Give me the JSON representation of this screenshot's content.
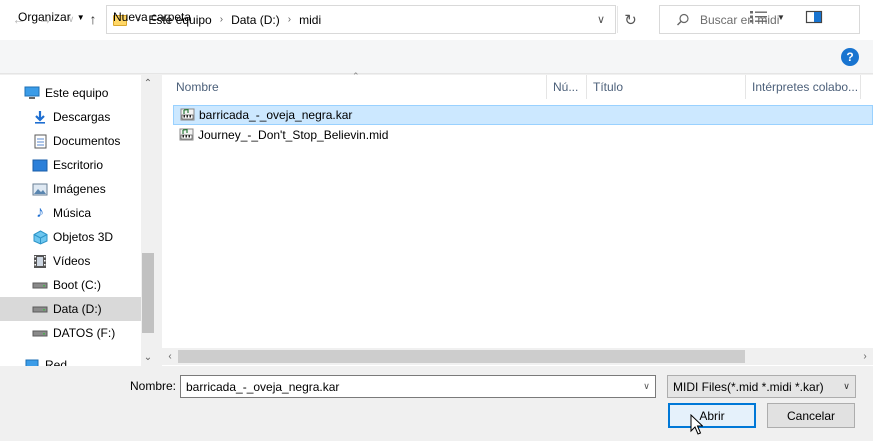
{
  "address_bar": {
    "crumbs": [
      "Este equipo",
      "Data (D:)",
      "midi"
    ]
  },
  "search": {
    "placeholder": "Buscar en midi"
  },
  "command_bar": {
    "organize_label": "Organizar",
    "new_folder_label": "Nueva carpeta"
  },
  "nav_pane": {
    "items": [
      {
        "label": "Este equipo",
        "icon": "computer-icon"
      },
      {
        "label": "Descargas",
        "icon": "download-icon"
      },
      {
        "label": "Documentos",
        "icon": "document-icon"
      },
      {
        "label": "Escritorio",
        "icon": "desktop-icon"
      },
      {
        "label": "Imágenes",
        "icon": "image-icon"
      },
      {
        "label": "Música",
        "icon": "music-icon"
      },
      {
        "label": "Objetos 3D",
        "icon": "cube-icon"
      },
      {
        "label": "Vídeos",
        "icon": "video-icon"
      },
      {
        "label": "Boot (C:)",
        "icon": "drive-icon"
      },
      {
        "label": "Data (D:)",
        "icon": "drive-icon"
      },
      {
        "label": "DATOS (F:)",
        "icon": "drive-icon"
      },
      {
        "label": "Red",
        "icon": "network-icon"
      }
    ]
  },
  "columns": [
    "Nombre",
    "Nú...",
    "Título",
    "Intérpretes colabo..."
  ],
  "files": [
    {
      "name": "barricada_-_oveja_negra.kar",
      "selected": true
    },
    {
      "name": "Journey_-_Don't_Stop_Believin.mid",
      "selected": false
    }
  ],
  "bottom": {
    "filename_label": "Nombre:",
    "filename_value": "barricada_-_oveja_negra.kar",
    "filetype_value": "MIDI Files(*.mid *.midi *.kar)",
    "open_label": "Abrir",
    "cancel_label": "Cancelar"
  },
  "colors": {
    "selection_bg": "#cce8ff",
    "accent": "#0078d7",
    "help_icon": "#1874d0"
  }
}
